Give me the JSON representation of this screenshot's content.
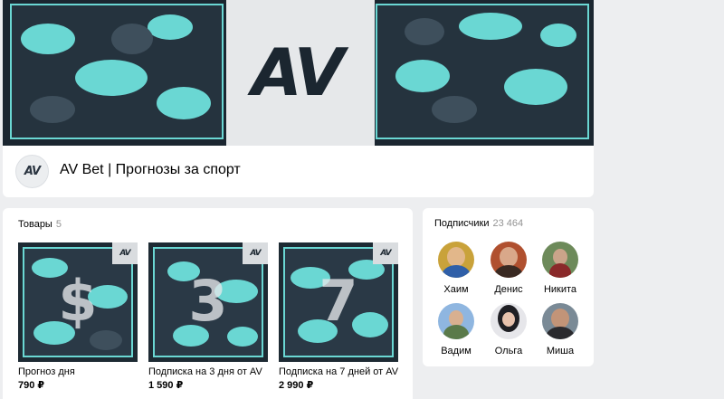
{
  "group": {
    "avatar_text": "AV",
    "name": "AV Bet | Прогнозы за спорт",
    "cover_logo": "AV"
  },
  "products": {
    "title": "Товары",
    "count": "5",
    "items": [
      {
        "digit": "$",
        "badge": "AV",
        "title": "Прогноз дня",
        "price": "790 ₽"
      },
      {
        "digit": "3",
        "badge": "AV",
        "title": "Подписка на 3 дня от AV",
        "price": "1 590 ₽"
      },
      {
        "digit": "7",
        "badge": "AV",
        "title": "Подписка на 7 дней от AV",
        "price": "2 990 ₽"
      }
    ]
  },
  "followers": {
    "title": "Подписчики",
    "count": "23 464",
    "items": [
      {
        "name": "Хаим"
      },
      {
        "name": "Денис"
      },
      {
        "name": "Никита"
      },
      {
        "name": "Вадим"
      },
      {
        "name": "Ольга"
      },
      {
        "name": "Миша"
      }
    ]
  },
  "colors": {
    "accent_teal": "#6ad7d3",
    "cover_dark": "#1b2630",
    "page_bg": "#edeef0"
  }
}
